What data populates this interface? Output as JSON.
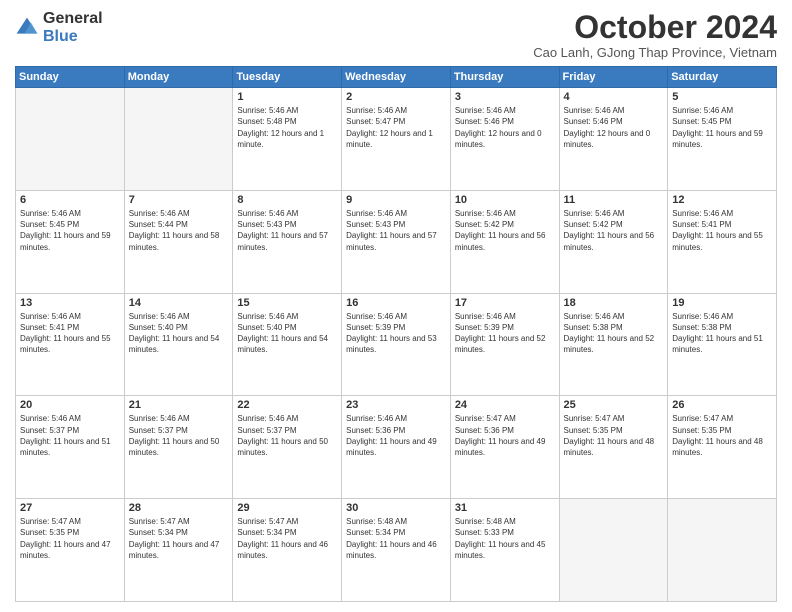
{
  "header": {
    "logo_general": "General",
    "logo_blue": "Blue",
    "month_title": "October 2024",
    "subtitle": "Cao Lanh, GJong Thap Province, Vietnam"
  },
  "days_of_week": [
    "Sunday",
    "Monday",
    "Tuesday",
    "Wednesday",
    "Thursday",
    "Friday",
    "Saturday"
  ],
  "weeks": [
    [
      {
        "day": "",
        "info": ""
      },
      {
        "day": "",
        "info": ""
      },
      {
        "day": "1",
        "info": "Sunrise: 5:46 AM\nSunset: 5:48 PM\nDaylight: 12 hours and 1 minute."
      },
      {
        "day": "2",
        "info": "Sunrise: 5:46 AM\nSunset: 5:47 PM\nDaylight: 12 hours and 1 minute."
      },
      {
        "day": "3",
        "info": "Sunrise: 5:46 AM\nSunset: 5:46 PM\nDaylight: 12 hours and 0 minutes."
      },
      {
        "day": "4",
        "info": "Sunrise: 5:46 AM\nSunset: 5:46 PM\nDaylight: 12 hours and 0 minutes."
      },
      {
        "day": "5",
        "info": "Sunrise: 5:46 AM\nSunset: 5:45 PM\nDaylight: 11 hours and 59 minutes."
      }
    ],
    [
      {
        "day": "6",
        "info": "Sunrise: 5:46 AM\nSunset: 5:45 PM\nDaylight: 11 hours and 59 minutes."
      },
      {
        "day": "7",
        "info": "Sunrise: 5:46 AM\nSunset: 5:44 PM\nDaylight: 11 hours and 58 minutes."
      },
      {
        "day": "8",
        "info": "Sunrise: 5:46 AM\nSunset: 5:43 PM\nDaylight: 11 hours and 57 minutes."
      },
      {
        "day": "9",
        "info": "Sunrise: 5:46 AM\nSunset: 5:43 PM\nDaylight: 11 hours and 57 minutes."
      },
      {
        "day": "10",
        "info": "Sunrise: 5:46 AM\nSunset: 5:42 PM\nDaylight: 11 hours and 56 minutes."
      },
      {
        "day": "11",
        "info": "Sunrise: 5:46 AM\nSunset: 5:42 PM\nDaylight: 11 hours and 56 minutes."
      },
      {
        "day": "12",
        "info": "Sunrise: 5:46 AM\nSunset: 5:41 PM\nDaylight: 11 hours and 55 minutes."
      }
    ],
    [
      {
        "day": "13",
        "info": "Sunrise: 5:46 AM\nSunset: 5:41 PM\nDaylight: 11 hours and 55 minutes."
      },
      {
        "day": "14",
        "info": "Sunrise: 5:46 AM\nSunset: 5:40 PM\nDaylight: 11 hours and 54 minutes."
      },
      {
        "day": "15",
        "info": "Sunrise: 5:46 AM\nSunset: 5:40 PM\nDaylight: 11 hours and 54 minutes."
      },
      {
        "day": "16",
        "info": "Sunrise: 5:46 AM\nSunset: 5:39 PM\nDaylight: 11 hours and 53 minutes."
      },
      {
        "day": "17",
        "info": "Sunrise: 5:46 AM\nSunset: 5:39 PM\nDaylight: 11 hours and 52 minutes."
      },
      {
        "day": "18",
        "info": "Sunrise: 5:46 AM\nSunset: 5:38 PM\nDaylight: 11 hours and 52 minutes."
      },
      {
        "day": "19",
        "info": "Sunrise: 5:46 AM\nSunset: 5:38 PM\nDaylight: 11 hours and 51 minutes."
      }
    ],
    [
      {
        "day": "20",
        "info": "Sunrise: 5:46 AM\nSunset: 5:37 PM\nDaylight: 11 hours and 51 minutes."
      },
      {
        "day": "21",
        "info": "Sunrise: 5:46 AM\nSunset: 5:37 PM\nDaylight: 11 hours and 50 minutes."
      },
      {
        "day": "22",
        "info": "Sunrise: 5:46 AM\nSunset: 5:37 PM\nDaylight: 11 hours and 50 minutes."
      },
      {
        "day": "23",
        "info": "Sunrise: 5:46 AM\nSunset: 5:36 PM\nDaylight: 11 hours and 49 minutes."
      },
      {
        "day": "24",
        "info": "Sunrise: 5:47 AM\nSunset: 5:36 PM\nDaylight: 11 hours and 49 minutes."
      },
      {
        "day": "25",
        "info": "Sunrise: 5:47 AM\nSunset: 5:35 PM\nDaylight: 11 hours and 48 minutes."
      },
      {
        "day": "26",
        "info": "Sunrise: 5:47 AM\nSunset: 5:35 PM\nDaylight: 11 hours and 48 minutes."
      }
    ],
    [
      {
        "day": "27",
        "info": "Sunrise: 5:47 AM\nSunset: 5:35 PM\nDaylight: 11 hours and 47 minutes."
      },
      {
        "day": "28",
        "info": "Sunrise: 5:47 AM\nSunset: 5:34 PM\nDaylight: 11 hours and 47 minutes."
      },
      {
        "day": "29",
        "info": "Sunrise: 5:47 AM\nSunset: 5:34 PM\nDaylight: 11 hours and 46 minutes."
      },
      {
        "day": "30",
        "info": "Sunrise: 5:48 AM\nSunset: 5:34 PM\nDaylight: 11 hours and 46 minutes."
      },
      {
        "day": "31",
        "info": "Sunrise: 5:48 AM\nSunset: 5:33 PM\nDaylight: 11 hours and 45 minutes."
      },
      {
        "day": "",
        "info": ""
      },
      {
        "day": "",
        "info": ""
      }
    ]
  ],
  "colors": {
    "header_bg": "#3a7abf",
    "header_text": "#ffffff",
    "border": "#cccccc",
    "empty_bg": "#f5f5f5"
  }
}
